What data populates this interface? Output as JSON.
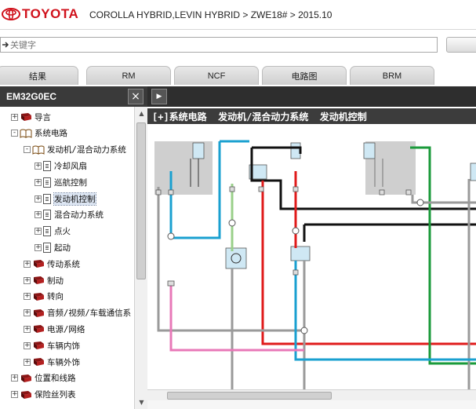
{
  "header": {
    "logo_text": "TOYOTA",
    "breadcrumb": "COROLLA HYBRID,LEVIN HYBRID > ZWE18# > 2015.10"
  },
  "search": {
    "placeholder": "关键字"
  },
  "tabs": [
    {
      "label": "结果"
    },
    {
      "label": "RM"
    },
    {
      "label": "NCF"
    },
    {
      "label": "电路图"
    },
    {
      "label": "BRM"
    }
  ],
  "left_panel": {
    "title": "EM32G0EC",
    "close_label": "×",
    "tree": [
      {
        "label": "导言",
        "expander": "+",
        "icon": "book-icon"
      },
      {
        "label": "系统电路",
        "expander": "-",
        "icon": "open-book-icon"
      },
      {
        "label": "发动机/混合动力系统",
        "expander": "-",
        "icon": "open-book-icon"
      },
      {
        "label": "冷却风扇",
        "expander": "+",
        "icon": "document-icon"
      },
      {
        "label": "巡航控制",
        "expander": "+",
        "icon": "document-icon"
      },
      {
        "label": "发动机控制",
        "expander": "+",
        "icon": "document-icon",
        "selected": true
      },
      {
        "label": "混合动力系统",
        "expander": "+",
        "icon": "document-icon"
      },
      {
        "label": "点火",
        "expander": "+",
        "icon": "document-icon"
      },
      {
        "label": "起动",
        "expander": "+",
        "icon": "document-icon"
      },
      {
        "label": "传动系统",
        "expander": "+",
        "icon": "book-icon"
      },
      {
        "label": "制动",
        "expander": "+",
        "icon": "book-icon"
      },
      {
        "label": "转向",
        "expander": "+",
        "icon": "book-icon"
      },
      {
        "label": "音频/视频/车载通信系",
        "expander": "+",
        "icon": "book-icon"
      },
      {
        "label": "电源/网络",
        "expander": "+",
        "icon": "book-icon"
      },
      {
        "label": "车辆内饰",
        "expander": "+",
        "icon": "book-icon"
      },
      {
        "label": "车辆外饰",
        "expander": "+",
        "icon": "book-icon"
      },
      {
        "label": "位置和线路",
        "expander": "+",
        "icon": "book-icon"
      },
      {
        "label": "保险丝列表",
        "expander": "+",
        "icon": "book-icon"
      }
    ]
  },
  "right_panel": {
    "expand_label": "▶",
    "diagram_title": "[+]系统电路  发动机/混合动力系统  发动机控制"
  },
  "colors": {
    "brand_red": "#d0111b",
    "wire_blue": "#1aa0d0",
    "wire_red": "#e01b1b",
    "wire_black": "#111111",
    "wire_green": "#1a9a3a",
    "wire_pink": "#e878b8",
    "wire_gray": "#9a9a9a",
    "wire_lightgreen": "#9ad08a",
    "panel_dark": "#3a3a3a"
  }
}
